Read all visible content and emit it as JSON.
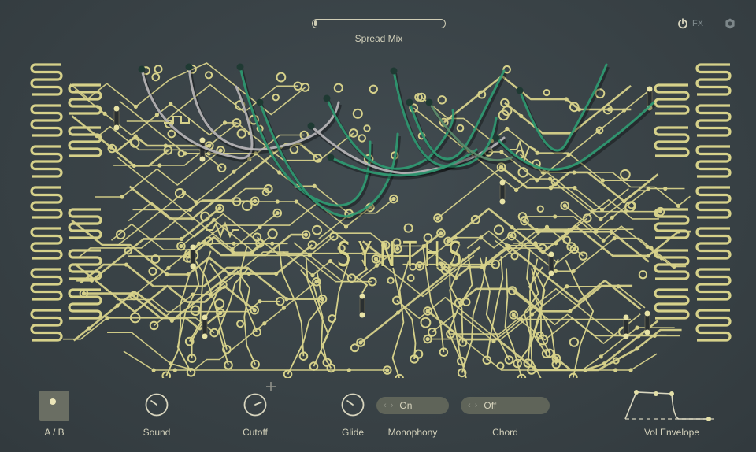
{
  "header": {
    "spread_mix": {
      "label": "Spread Mix",
      "value": 0.0
    },
    "fx": {
      "label": "FX",
      "icon": "power-icon",
      "enabled": false
    },
    "settings": {
      "icon": "gear-icon"
    }
  },
  "board": {
    "title": "SYNTHS",
    "colors": {
      "trace": "#d6d18a",
      "trace_bright": "#e8e3a6",
      "background": "#394246",
      "cable_green": "#2f9a72",
      "cable_gray": "#b8b6b8"
    }
  },
  "controls": {
    "ab": {
      "label": "A / B",
      "icon": "dot-icon"
    },
    "sound": {
      "label": "Sound",
      "value": 0.3
    },
    "cutoff": {
      "label": "Cutoff",
      "value": 0.75,
      "modifier_icon": "plus-icon"
    },
    "glide": {
      "label": "Glide",
      "value": 0.3
    },
    "monophony": {
      "label": "Monophony",
      "value": "On",
      "arrows": "‹ ›"
    },
    "chord": {
      "label": "Chord",
      "value": "Off",
      "arrows": "‹ ›"
    },
    "vol_envelope": {
      "label": "Vol Envelope"
    }
  }
}
